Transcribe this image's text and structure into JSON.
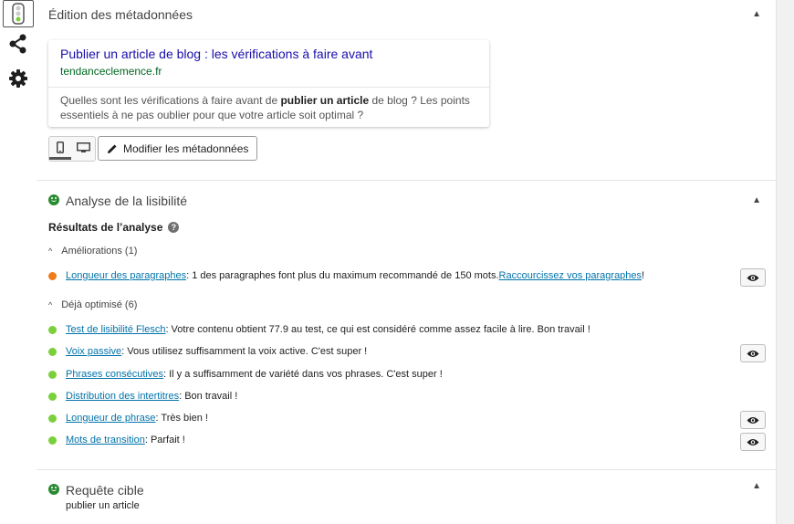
{
  "sidebar": {
    "items": [
      {
        "icon": "traffic-light-icon",
        "active": true
      },
      {
        "icon": "share-icon",
        "active": false
      },
      {
        "icon": "gear-icon",
        "active": false
      }
    ]
  },
  "metadata": {
    "title": "Édition des métadonnées",
    "snippet": {
      "title": "Publier un article de blog : les vérifications à faire avant",
      "url": "tendanceclemence.fr",
      "desc_before": "Quelles sont les vérifications à faire avant de ",
      "desc_bold": "publier un article",
      "desc_after": " de blog ? Les points essentiels à ne pas oublier pour que votre article soit optimal ?"
    },
    "edit_button": "Modifier les métadonnées",
    "device_icons": [
      "mobile-icon",
      "desktop-icon"
    ]
  },
  "readability": {
    "title": "Analyse de la lisibilité",
    "results_title": "Résultats de l’analyse",
    "help_glyph": "?",
    "improvements": {
      "label": "Améliorations (1)",
      "items": [
        {
          "link": "Longueur des paragraphes",
          "text": " : 1 des paragraphes font plus du maximum recommandé de 150 mots. ",
          "link2": "Raccourcissez vos paragraphes",
          "text2": " !",
          "color": "#ee7c1b",
          "eye": true
        }
      ]
    },
    "optimized": {
      "label": "Déjà optimisé (6)",
      "items": [
        {
          "link": "Test de lisibilité Flesch",
          "text": " : Votre contenu obtient 77.9 au test, ce qui est considéré comme assez facile à lire. Bon travail !",
          "color": "#7ad03a",
          "eye": false
        },
        {
          "link": "Voix passive",
          "text": " : Vous utilisez suffisamment la voix active. C'est super !",
          "color": "#7ad03a",
          "eye": true
        },
        {
          "link": "Phrases consécutives",
          "text": " : Il y a suffisamment de variété dans vos phrases. C'est super !",
          "color": "#7ad03a",
          "eye": false
        },
        {
          "link": "Distribution des intertitres",
          "text": " : Bon travail !",
          "color": "#7ad03a",
          "eye": false
        },
        {
          "link": "Longueur de phrase",
          "text": " : Très bien !",
          "color": "#7ad03a",
          "eye": true
        },
        {
          "link": "Mots de transition",
          "text": " : Parfait !",
          "color": "#7ad03a",
          "eye": true
        }
      ]
    }
  },
  "keyword": {
    "title": "Requête cible",
    "value": "publier un article"
  },
  "arrow_glyph": "▲",
  "chevron_glyph": "^"
}
